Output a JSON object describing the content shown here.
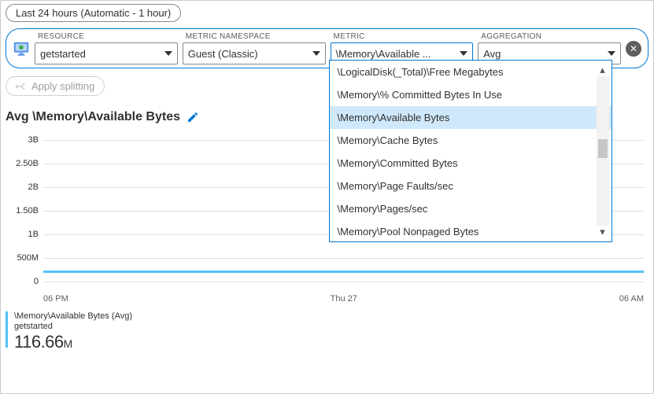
{
  "timeRange": "Last 24 hours (Automatic - 1 hour)",
  "labels": {
    "resource": "RESOURCE",
    "namespace": "METRIC NAMESPACE",
    "metric": "METRIC",
    "aggregation": "AGGREGATION"
  },
  "values": {
    "resource": "getstarted",
    "namespace": "Guest (Classic)",
    "metric": "\\Memory\\Available ...",
    "aggregation": "Avg"
  },
  "applySplitting": "Apply splitting",
  "chartTitle": "Avg \\Memory\\Available Bytes",
  "metricOptions": [
    {
      "label": "\\LogicalDisk(_Total)\\Free Megabytes",
      "selected": false
    },
    {
      "label": "\\Memory\\% Committed Bytes In Use",
      "selected": false
    },
    {
      "label": "\\Memory\\Available Bytes",
      "selected": true
    },
    {
      "label": "\\Memory\\Cache Bytes",
      "selected": false
    },
    {
      "label": "\\Memory\\Committed Bytes",
      "selected": false
    },
    {
      "label": "\\Memory\\Page Faults/sec",
      "selected": false
    },
    {
      "label": "\\Memory\\Pages/sec",
      "selected": false
    },
    {
      "label": "\\Memory\\Pool Nonpaged Bytes",
      "selected": false
    }
  ],
  "yTicks": [
    "3B",
    "2.50B",
    "2B",
    "1.50B",
    "1B",
    "500M",
    "0"
  ],
  "xTicks": [
    "06 PM",
    "Thu 27",
    "06 AM"
  ],
  "legend": {
    "metric": "\\Memory\\Available Bytes (Avg)",
    "resource": "getstarted",
    "value": "116.66",
    "unit": "M"
  },
  "chart_data": {
    "type": "line",
    "title": "Avg \\Memory\\Available Bytes",
    "xlabel": "",
    "ylabel": "",
    "ylim": [
      0,
      3000000000
    ],
    "x": [
      "06 PM",
      "Thu 27",
      "06 AM"
    ],
    "series": [
      {
        "name": "\\Memory\\Available Bytes (Avg) getstarted",
        "values": [
          116660000,
          116660000,
          116660000
        ]
      }
    ]
  }
}
